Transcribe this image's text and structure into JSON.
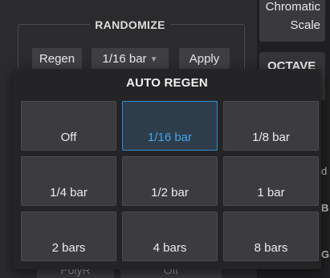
{
  "randomize": {
    "title": "RANDOMIZE",
    "regen_label": "Regen",
    "rate_value": "1/16 bar",
    "apply_label": "Apply"
  },
  "scale": {
    "line1": "Chromatic",
    "line2": "Scale"
  },
  "octave": {
    "label": "OCTAVE"
  },
  "side_fragments": [
    "d",
    "B",
    "G"
  ],
  "bottom_fragments": [
    "PolyR",
    "Off"
  ],
  "popup": {
    "title": "AUTO REGEN",
    "options": [
      "Off",
      "1/16 bar",
      "1/8 bar",
      "1/4 bar",
      "1/2 bar",
      "1 bar",
      "2 bars",
      "4 bars",
      "8 bars"
    ],
    "selected": "1/16 bar"
  },
  "colors": {
    "accent": "#3ea6f0",
    "selected_border": "#2f8fd4",
    "panel_bg": "#2b2b2d"
  }
}
